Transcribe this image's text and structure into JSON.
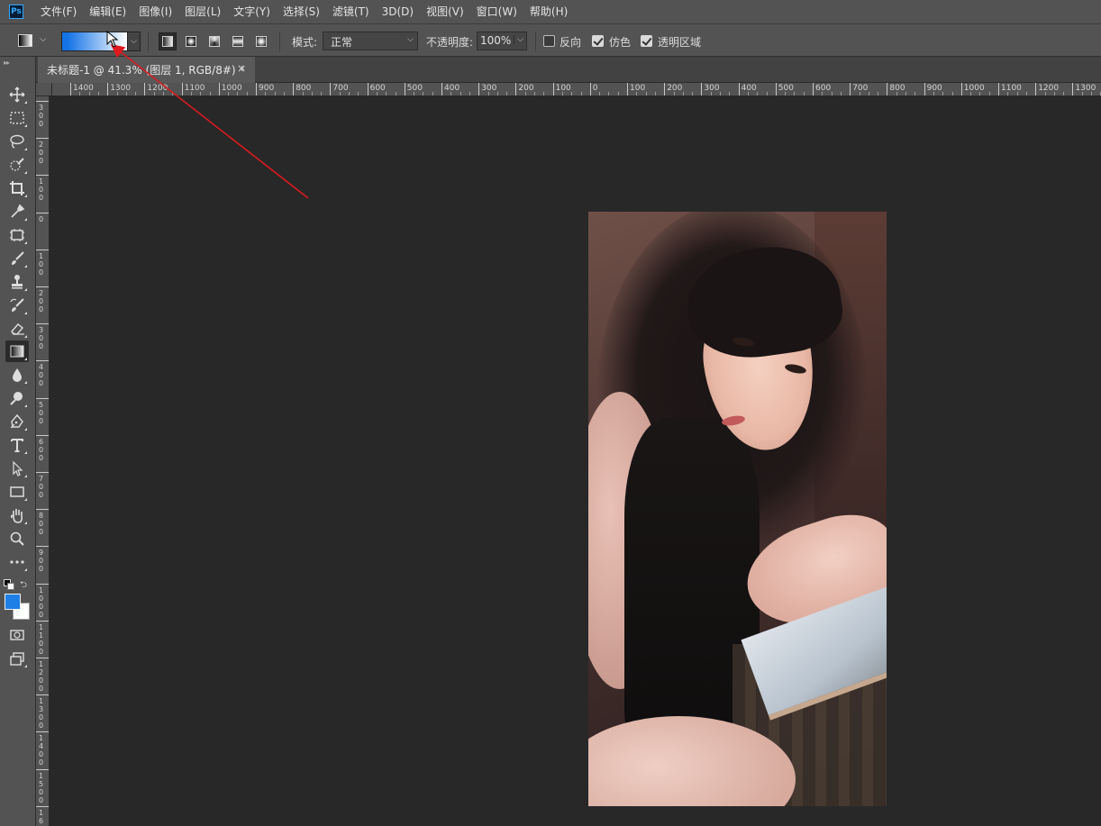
{
  "app": {
    "logo": "Ps"
  },
  "menu": [
    {
      "label": "文件(F)"
    },
    {
      "label": "编辑(E)"
    },
    {
      "label": "图像(I)"
    },
    {
      "label": "图层(L)"
    },
    {
      "label": "文字(Y)"
    },
    {
      "label": "选择(S)"
    },
    {
      "label": "滤镜(T)"
    },
    {
      "label": "3D(D)"
    },
    {
      "label": "视图(V)"
    },
    {
      "label": "窗口(W)"
    },
    {
      "label": "帮助(H)"
    }
  ],
  "options": {
    "gradient_colors": [
      "#1473e6",
      "#ffffff"
    ],
    "mode_label": "模式:",
    "mode_value": "正常",
    "opacity_label": "不透明度:",
    "opacity_value": "100%",
    "reverse_label": "反向",
    "reverse_checked": false,
    "dither_label": "仿色",
    "dither_checked": true,
    "transparency_label": "透明区域",
    "transparency_checked": true
  },
  "document_tab": {
    "title": "未标题-1 @ 41.3% (图层 1, RGB/8#) *",
    "close": "×"
  },
  "colors": {
    "foreground": "#1e7fe6",
    "background": "#ffffff",
    "workspace": "#282828"
  },
  "rulers": {
    "horizontal": [
      "1400",
      "1300",
      "1200",
      "1100",
      "1000",
      "900",
      "800",
      "700",
      "600",
      "500",
      "400",
      "300",
      "200",
      "100",
      "0",
      "100",
      "200",
      "300",
      "400",
      "500",
      "600",
      "700",
      "800",
      "900",
      "1000",
      "1100",
      "1200",
      "1300"
    ],
    "vertical": [
      "300",
      "200",
      "100",
      "0",
      "100",
      "200",
      "300",
      "400",
      "500",
      "600",
      "700",
      "800",
      "900",
      "1000",
      "1100",
      "1200",
      "1300",
      "1400",
      "1500",
      "16"
    ]
  },
  "toolbar": {
    "tools": [
      "move-icon",
      "marquee-icon",
      "lasso-icon",
      "quick-select-icon",
      "crop-icon",
      "eyedropper-icon",
      "frame-icon",
      "brush-icon",
      "stamp-icon",
      "history-brush-icon",
      "eraser-icon",
      "gradient-icon",
      "blur-icon",
      "dodge-icon",
      "pen-icon",
      "type-icon",
      "path-select-icon",
      "rectangle-icon",
      "hand-icon",
      "zoom-icon",
      "more-icon"
    ],
    "active_tool": "gradient-icon"
  }
}
